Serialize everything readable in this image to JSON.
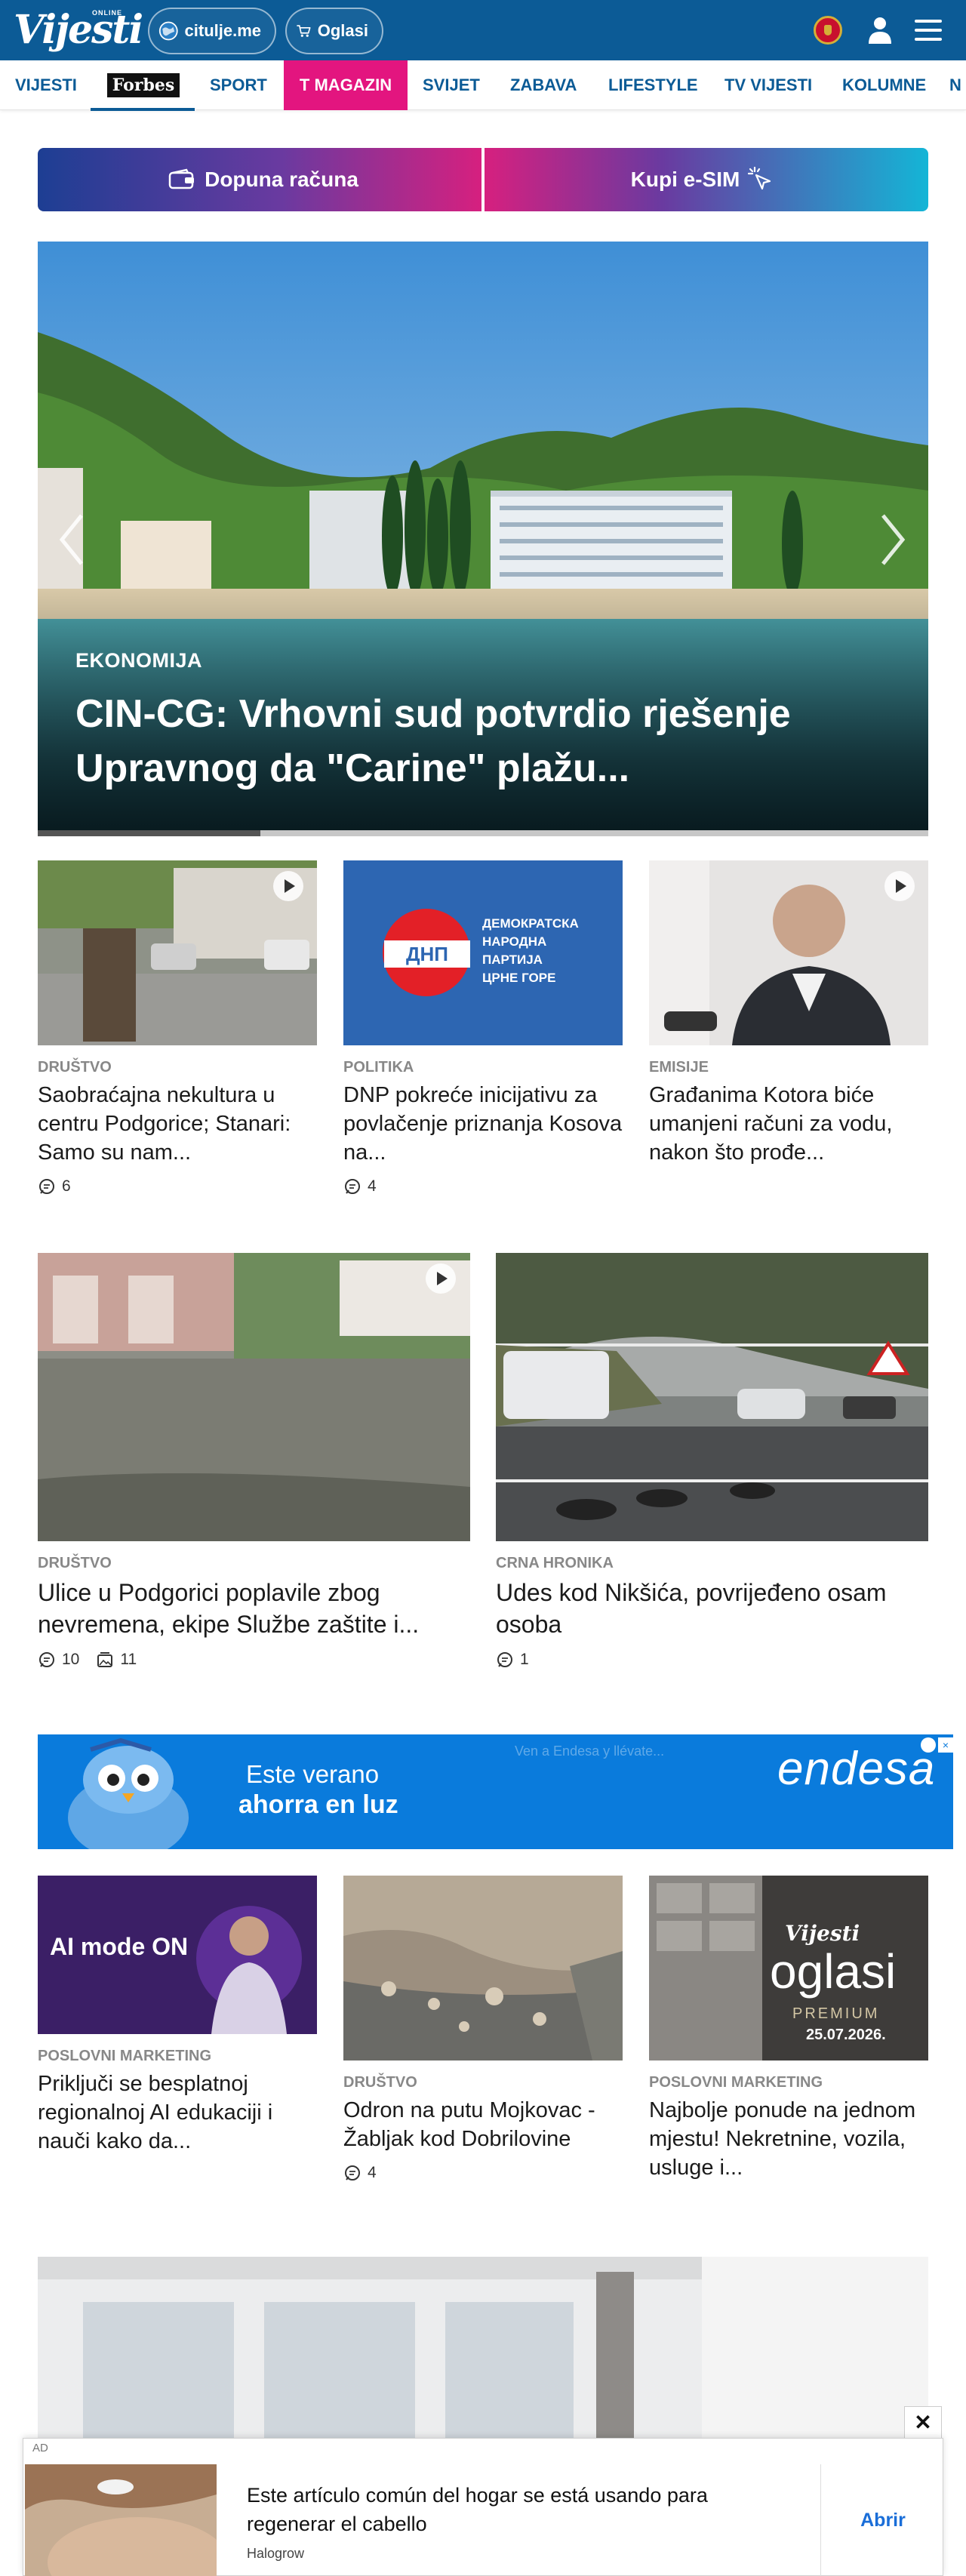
{
  "header": {
    "logo_small": "ONLINE",
    "logo_text": "Vijesti",
    "citulje_label": "citulje.me",
    "oglasi_label": "Oglasi",
    "icons": [
      "globe-icon",
      "cart-icon",
      "flag-icon",
      "user-icon",
      "menu-icon"
    ]
  },
  "nav": {
    "items": [
      "VIJESTI",
      "Forbes",
      "SPORT",
      "T MAGAZIN",
      "SVIJET",
      "ZABAVA",
      "LIFESTYLE",
      "TV VIJESTI",
      "KOLUMNE",
      "N"
    ],
    "active": "Forbes",
    "highlight_color": "#e3157f",
    "brand_color": "#0c5b96"
  },
  "banners": {
    "topup_label": "Dopuna računa",
    "esim_label": "Kupi e-SIM"
  },
  "hero": {
    "category": "EKONOMIJA",
    "title": "CIN-CG: Vrhovni sud potvrdio rješenje Upravnog da \"Carine\" plažu...",
    "progress": 0.25
  },
  "row1": [
    {
      "category": "DRUŠTVO",
      "title": "Saobraćajna nekultura u centru Podgorice; Stanari: Samo su nam...",
      "comments": "6",
      "video": true
    },
    {
      "category": "POLITIKA",
      "title": "DNP pokreće inicijativu za povlačenje priznanja Kosova na...",
      "comments": "4",
      "video": false,
      "image_text": [
        "ДЕМОКРАТСКА",
        "НАРОДНА",
        "ПАРТИЈА",
        "ЦРНЕ ГОРЕ"
      ],
      "image_logo": "ДНП"
    },
    {
      "category": "EMISIJE",
      "title": "Građanima Kotora biće umanjeni računi za vodu, nakon što prođe...",
      "comments": null,
      "video": true
    }
  ],
  "row2": [
    {
      "category": "DRUŠTVO",
      "title": "Ulice u Podgorici poplavile zbog nevremena, ekipe Službe zaštite i...",
      "comments": "10",
      "photos": "11",
      "video": true
    },
    {
      "category": "CRNA HRONIKA",
      "title": "Udes kod Nikšića, povrijeđeno osam osoba",
      "comments": "1",
      "video": false
    }
  ],
  "ad": {
    "line1": "Este verano",
    "line2": "ahorra en luz",
    "small": "Ven a Endesa y llévate...",
    "brand": "endesa"
  },
  "row3": [
    {
      "category": "POSLOVNI MARKETING",
      "title": "Priključi se besplatnoj regionalnoj AI edukaciji i nauči kako da...",
      "comments": null,
      "image_text": "AI mode ON"
    },
    {
      "category": "DRUŠTVO",
      "title": "Odron na putu Mojkovac - Žabljak kod Dobrilovine",
      "comments": "4"
    },
    {
      "category": "POSLOVNI MARKETING",
      "title": "Najbolje ponude na jednom mjestu! Nekretnine, vozila, usluge i...",
      "comments": null,
      "image_brand": "Vijesti",
      "image_word": "oglasi",
      "image_sub": "PREMIUM",
      "image_date": "25.07.2026."
    }
  ],
  "sticky_ad": {
    "label": "AD",
    "text": "Este artículo común del hogar se está usando para regenerar el cabello",
    "brand": "Halogrow",
    "cta": "Abrir",
    "close": "✕"
  }
}
